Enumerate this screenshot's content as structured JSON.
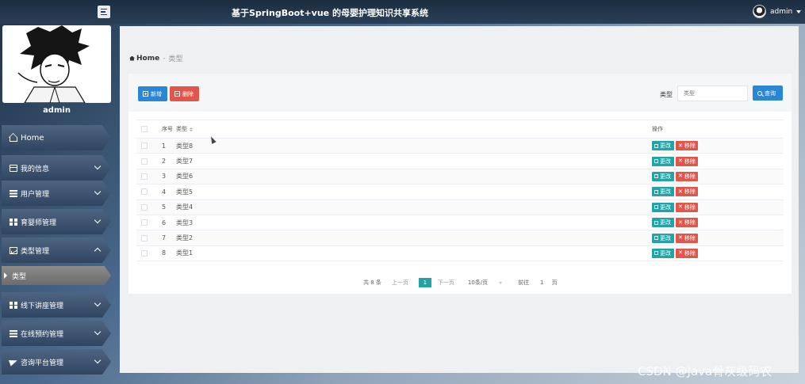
{
  "header": {
    "title": "基于SpringBoot+vue 的母婴护理知识共享系统",
    "user": "admin"
  },
  "sidebar": {
    "profile_name": "admin",
    "items": [
      {
        "label": "Home"
      },
      {
        "label": "我的信息"
      },
      {
        "label": "用户管理"
      },
      {
        "label": "育婴师管理"
      },
      {
        "label": "类型管理"
      },
      {
        "label": "线下讲座管理"
      },
      {
        "label": "在线预约管理"
      },
      {
        "label": "咨询平台管理"
      }
    ],
    "sub_item": "类型"
  },
  "breadcrumb": {
    "home": "Home",
    "sep": "-",
    "current": "类型"
  },
  "toolbar": {
    "add_label": "新增",
    "delete_label": "删除",
    "filter_label": "类型",
    "filter_placeholder": "类型",
    "search_label": "查询"
  },
  "table": {
    "headers": {
      "no": "序号",
      "type": "类型",
      "op": "操作"
    },
    "edit_label": "更改",
    "remove_label": "移除",
    "rows": [
      {
        "no": "1",
        "type": "类型8"
      },
      {
        "no": "2",
        "type": "类型7"
      },
      {
        "no": "3",
        "type": "类型6"
      },
      {
        "no": "4",
        "type": "类型5"
      },
      {
        "no": "5",
        "type": "类型4"
      },
      {
        "no": "6",
        "type": "类型3"
      },
      {
        "no": "7",
        "type": "类型2"
      },
      {
        "no": "8",
        "type": "类型1"
      }
    ]
  },
  "pager": {
    "total": "共 8 条",
    "prev": "上一页",
    "current": "1",
    "next": "下一页",
    "page_size": "10条/页",
    "goto": "前往",
    "goto_value": "1",
    "page_unit": "页"
  },
  "watermark": "CSDN @Java骨灰级码农",
  "colors": {
    "primary": "#2b86d4",
    "danger": "#e0564a",
    "teal": "#23a3a7",
    "topbar": "#1c2d40"
  }
}
